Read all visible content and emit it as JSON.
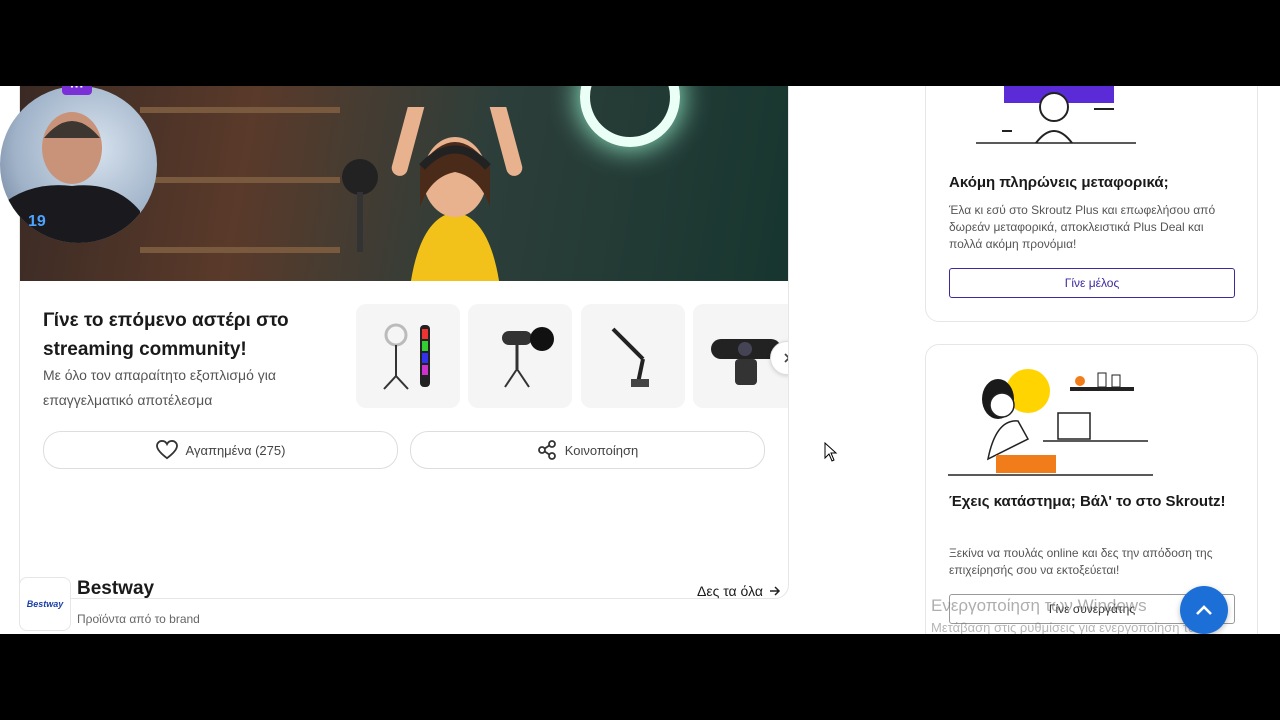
{
  "promo": {
    "title": "Γίνε το επόμενο αστέρι στο streaming community!",
    "subtitle": "Με όλο τον απαραίτητο εξοπλισμό για επαγγελματικό αποτέλεσμα",
    "favorites_label": "Αγαπημένα (275)",
    "share_label": "Κοινοποίηση"
  },
  "brand": {
    "logo_text": "Bestway",
    "name": "Bestway",
    "subtitle": "Προϊόντα από το brand",
    "see_all": "Δες τα όλα"
  },
  "plus_card": {
    "title": "Ακόμη πληρώνεις μεταφορικά;",
    "text": "Έλα κι εσύ στο Skroutz Plus και επωφελήσου από δωρεάν μεταφορικά, αποκλειστικά Plus Deal και πολλά ακόμη προνόμια!",
    "button": "Γίνε μέλος"
  },
  "shop_card": {
    "title": "Έχεις κατάστημα; Βάλ' το στο Skroutz!",
    "text": "Ξεκίνα να πουλάς online και δες την απόδοση της επιχείρησής σου να εκτοξεύεται!",
    "button": "Γίνε συνεργάτης"
  },
  "windows": {
    "line1": "Ενεργοποίηση των Windows",
    "line2": "Μετάβαση στις ρυθμίσεις για ενεργοποίηση των"
  },
  "webcam": {
    "menu": "···"
  },
  "colors": {
    "accent": "#3b2a9c",
    "scroll_button": "#1d6fd8"
  }
}
